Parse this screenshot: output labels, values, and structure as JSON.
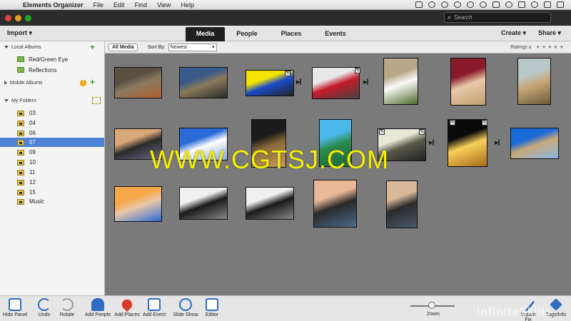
{
  "menubar": {
    "app_name": "Elements Organizer",
    "menus": [
      "File",
      "Edit",
      "Find",
      "View",
      "Help"
    ]
  },
  "search": {
    "placeholder": "Search"
  },
  "toolbar": {
    "import_label": "Import",
    "tabs": [
      "Media",
      "People",
      "Places",
      "Events"
    ],
    "active_tab": "Media",
    "create_label": "Create",
    "share_label": "Share"
  },
  "sidebar": {
    "local_albums": "Local Albums",
    "albums": [
      "Red/Green Eye",
      "Reflections"
    ],
    "mobile_albums": "Mobile Albums",
    "my_folders": "My Folders",
    "folders": [
      "03",
      "04",
      "06",
      "07",
      "09",
      "10",
      "11",
      "12",
      "15",
      "Music"
    ],
    "selected_folder": "07"
  },
  "subtoolbar": {
    "all_media": "All Media",
    "sort_by_label": "Sort By:",
    "sort_value": "Newest",
    "ratings_label": "Ratings",
    "ratings_op": "≥",
    "stars": "★★★★★"
  },
  "thumbs": [
    {
      "name": "photo-pumpkin-ground",
      "colors": [
        "#5a5040",
        "#8a7a60",
        "#b46030"
      ]
    },
    {
      "name": "photo-pier-boats",
      "colors": [
        "#3a5a8a",
        "#8a7a5a",
        "#2a2a2a"
      ]
    },
    {
      "name": "photo-blue-car",
      "colors": [
        "#f2e400",
        "#1a4acb",
        "#222222"
      ]
    },
    {
      "name": "photo-umbrella-walker",
      "colors": [
        "#e8e8e8",
        "#c41a2a",
        "#444444"
      ]
    },
    {
      "name": "photo-house",
      "colors": [
        "#b8a888",
        "#fafafa",
        "#4a6a2a"
      ]
    },
    {
      "name": "photo-elderly-woman",
      "colors": [
        "#8a1a2a",
        "#e8c8a8",
        "#c0a070"
      ]
    },
    {
      "name": "photo-pagoda",
      "colors": [
        "#b8c8c8",
        "#c8a878",
        "#6a5a3a"
      ]
    },
    {
      "name": "photo-tree-sunset",
      "colors": [
        "#d8a878",
        "#2a2a2a",
        "#6a6a8a"
      ]
    },
    {
      "name": "photo-clouds",
      "colors": [
        "#2a6ad8",
        "#ffffff",
        "#8aa8d8"
      ]
    },
    {
      "name": "photo-owl-statue",
      "colors": [
        "#1a1a1a",
        "#8a6a3a",
        "#c89a5a"
      ]
    },
    {
      "name": "photo-island-rock",
      "colors": [
        "#4ab8e8",
        "#2a8a4a",
        "#1a6a3a"
      ]
    },
    {
      "name": "photo-group-frame",
      "colors": [
        "#e8e8d8",
        "#5a5a4a",
        "#222222"
      ]
    },
    {
      "name": "photo-candle",
      "colors": [
        "#0a0a0a",
        "#f8d05a",
        "#a86a1a"
      ]
    },
    {
      "name": "photo-beach",
      "colors": [
        "#1a6ad8",
        "#c8a878",
        "#8ab8e8"
      ]
    },
    {
      "name": "photo-girl-smiling",
      "colors": [
        "#f8a848",
        "#e8c8a8",
        "#2a6ad8"
      ]
    },
    {
      "name": "photo-white-cat",
      "colors": [
        "#f0f0f0",
        "#1a1a1a",
        "#888888"
      ]
    },
    {
      "name": "photo-white-cat-2",
      "colors": [
        "#f0f0f0",
        "#1a1a1a",
        "#888888"
      ]
    },
    {
      "name": "photo-man-glasses",
      "colors": [
        "#e8b898",
        "#2a2a2a",
        "#4a6a8a"
      ]
    },
    {
      "name": "photo-young-man",
      "colors": [
        "#d8b898",
        "#2a2a2a",
        "#4a5a6a"
      ]
    }
  ],
  "bottombar": {
    "hide_panel": "Hide Panel",
    "undo": "Undo",
    "rotate": "Rotate",
    "add_people": "Add People",
    "add_places": "Add Places",
    "add_event": "Add Event",
    "slide_show": "Slide Show",
    "editor": "Editor",
    "zoom": "Zoom",
    "instant_fix": "Instant Fix",
    "tags_info": "Tags/Info"
  },
  "watermark": {
    "main": "WWW.CGTSJ.COM",
    "corner": "InfiniteSkills"
  },
  "colors": {
    "accent_blue": "#4e82d4",
    "tab_dark": "#1f1f1f",
    "grid_bg": "#7a7a7a",
    "watermark_yellow": "#f5f000"
  }
}
